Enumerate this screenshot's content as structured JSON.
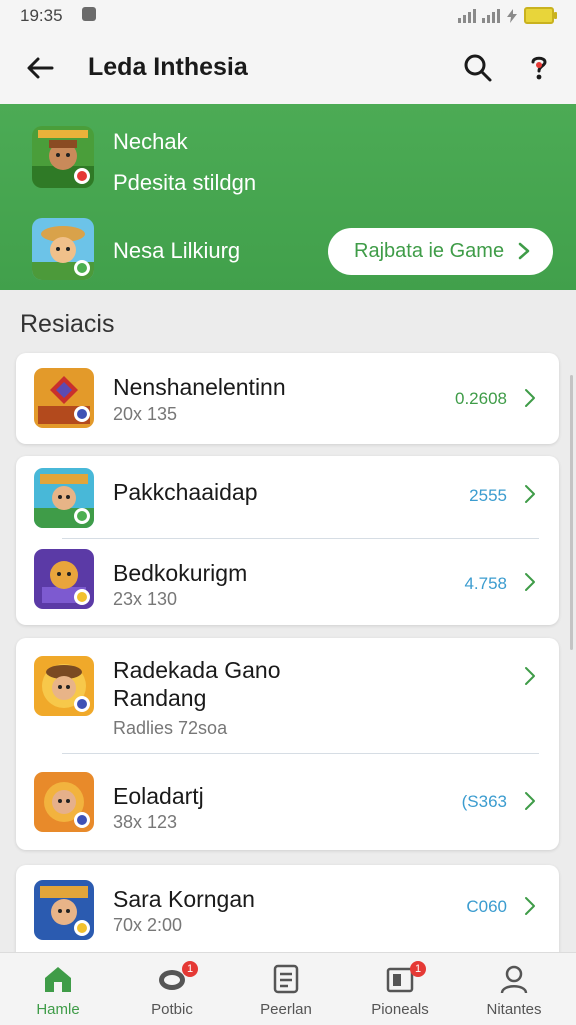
{
  "status": {
    "time": "19:35"
  },
  "app_bar": {
    "title": "Leda Inthesia"
  },
  "banner": {
    "name": "Nechak",
    "subtitle": "Pdesita stildgn",
    "name2": "Nesa Lilkiurg",
    "button_label": "Rajbata ie Game"
  },
  "section": {
    "title": "Resiacis"
  },
  "cards": [
    {
      "rows": [
        {
          "name": "Nenshanelentinn",
          "meta": "20x 135",
          "value": "0.2608"
        }
      ]
    },
    {
      "rows": [
        {
          "name": "Pakkchaaidap",
          "meta": "",
          "value": "2555"
        },
        {
          "name": "Bedkokurigm",
          "meta": "23x 130",
          "value": "4.758"
        }
      ]
    },
    {
      "rows": [
        {
          "name": "Radekada Gano Randang",
          "meta": "Radlies 72soa",
          "value": ""
        },
        {
          "name": "Eoladartj",
          "meta": "38x 123",
          "value": "(S363"
        }
      ]
    },
    {
      "rows": [
        {
          "name": "Sara Korngan",
          "meta": "70x 2:00",
          "value": "C060"
        }
      ]
    }
  ],
  "colors": {
    "accent": "#41a04b",
    "value_green": "#3f9c48",
    "value_blue": "#3b9ccf"
  },
  "nav": [
    {
      "label": "Hamle",
      "icon": "home-icon",
      "active": true
    },
    {
      "label": "Potbic",
      "icon": "chat-icon",
      "badge": "1"
    },
    {
      "label": "Peerlan",
      "icon": "document-icon"
    },
    {
      "label": "Pioneals",
      "icon": "cards-icon",
      "badge": "1"
    },
    {
      "label": "Nitantes",
      "icon": "profile-icon"
    }
  ]
}
